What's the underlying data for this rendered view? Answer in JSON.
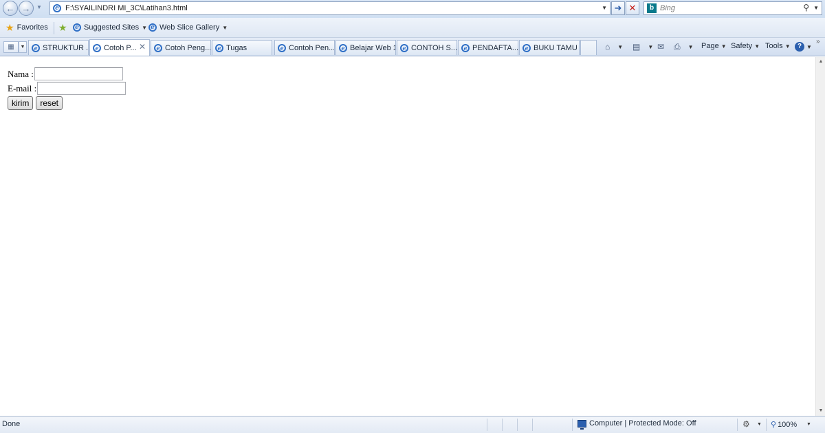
{
  "address_bar": {
    "url": "F:\\SYAILINDRI MI_3C\\Latihan3.html",
    "search_placeholder": "Bing"
  },
  "favorites_bar": {
    "favorites_label": "Favorites",
    "suggested_sites_label": "Suggested Sites",
    "web_slice_label": "Web Slice Gallery"
  },
  "tabs": [
    {
      "label": "STRUKTUR ...",
      "active": false
    },
    {
      "label": "Cotoh P...",
      "active": true
    },
    {
      "label": "Cotoh Peng...",
      "active": false
    },
    {
      "label": "Tugas",
      "active": false
    },
    {
      "label": "Contoh Pen...",
      "active": false
    },
    {
      "label": "Belajar Web 1",
      "active": false
    },
    {
      "label": "CONTOH S...",
      "active": false
    },
    {
      "label": "PENDAFTA...",
      "active": false
    },
    {
      "label": "BUKU TAMU",
      "active": false
    }
  ],
  "command_bar": {
    "page_label": "Page",
    "safety_label": "Safety",
    "tools_label": "Tools",
    "help_label": "?"
  },
  "form": {
    "nama_label": "Nama :",
    "nama_value": "",
    "email_label": "E-mail :",
    "email_value": "",
    "submit_label": "kirim",
    "reset_label": "reset"
  },
  "status_bar": {
    "status_text": "Done",
    "zone_text": "Computer | Protected Mode: Off",
    "zoom_level": "100%"
  },
  "colors": {
    "chrome_blue": "#dbe7f6",
    "stop_red": "#c8201a",
    "link_blue": "#2b5fae"
  }
}
